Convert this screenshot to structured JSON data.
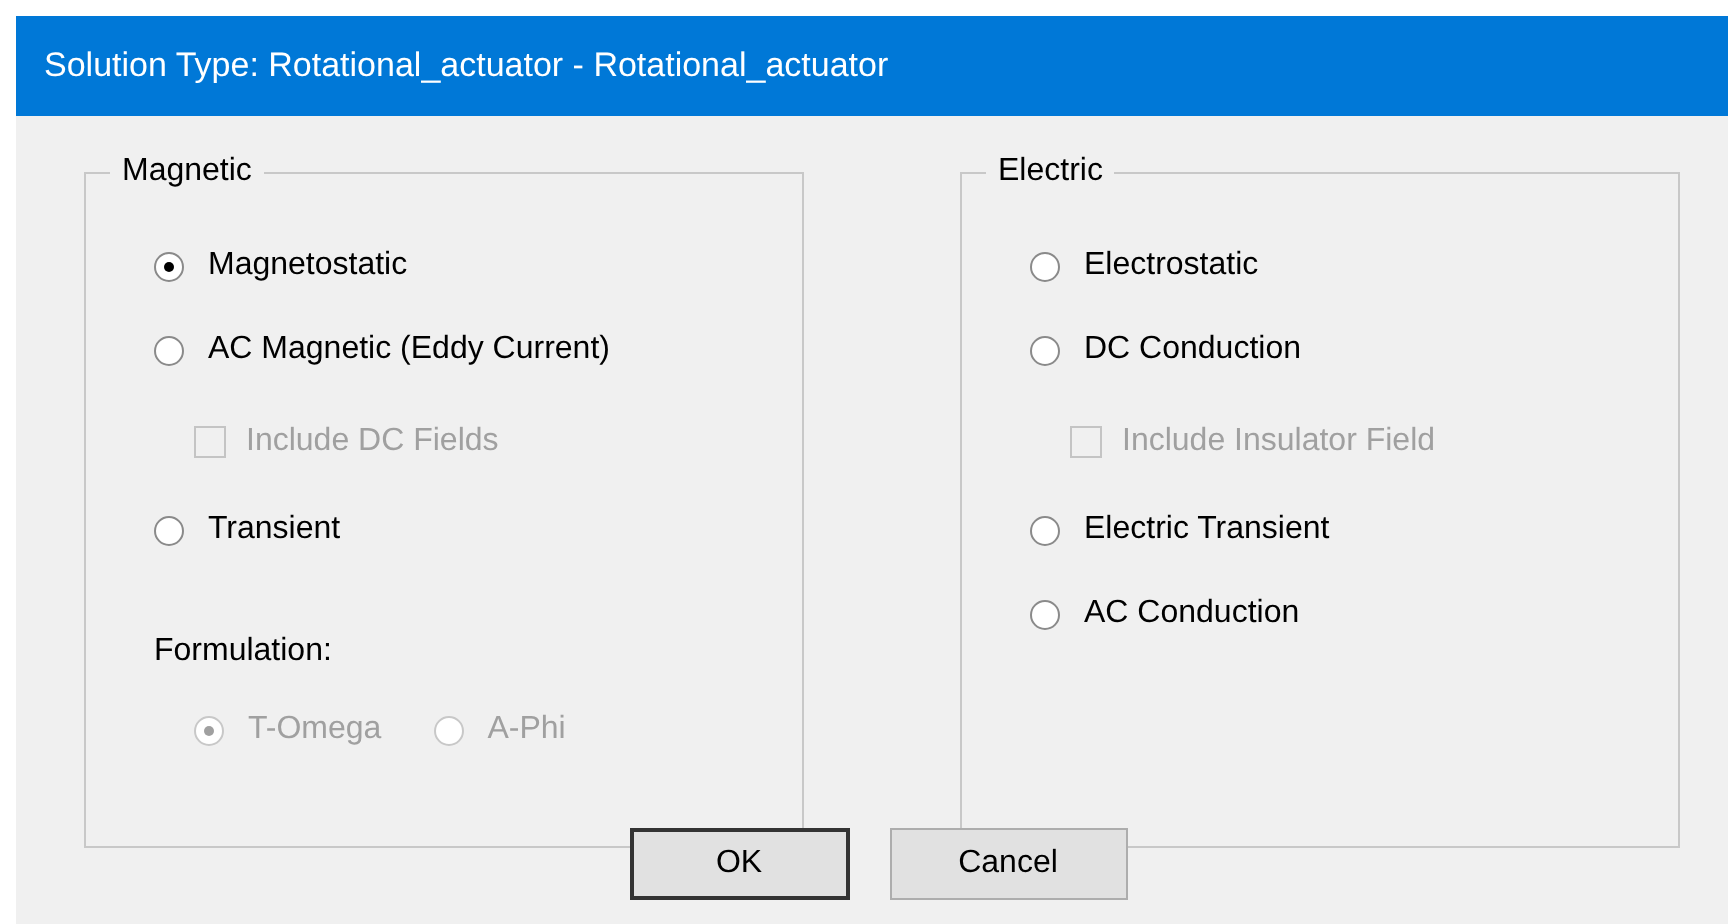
{
  "window": {
    "title": "Solution Type: Rotational_actuator - Rotational_actuator"
  },
  "groups": [
    {
      "title": "Magnetic",
      "items": [
        {
          "kind": "radio",
          "label": "Magnetostatic",
          "selected": true,
          "disabled": false
        },
        {
          "kind": "radio",
          "label": "AC Magnetic (Eddy Current)",
          "selected": false,
          "disabled": false
        },
        {
          "kind": "checkbox",
          "label": "Include DC Fields",
          "checked": false,
          "disabled": true
        },
        {
          "kind": "radio",
          "label": "Transient",
          "selected": false,
          "disabled": false
        },
        {
          "kind": "label",
          "label": "Formulation:"
        },
        {
          "kind": "radio_row",
          "options": [
            {
              "label": "T-Omega",
              "selected": true,
              "disabled": true
            },
            {
              "label": "A-Phi",
              "selected": false,
              "disabled": true
            }
          ]
        }
      ]
    },
    {
      "title": "Electric",
      "items": [
        {
          "kind": "radio",
          "label": "Electrostatic",
          "selected": false,
          "disabled": false
        },
        {
          "kind": "radio",
          "label": "DC Conduction",
          "selected": false,
          "disabled": false
        },
        {
          "kind": "checkbox",
          "label": "Include Insulator Field",
          "checked": false,
          "disabled": true
        },
        {
          "kind": "radio",
          "label": "Electric Transient",
          "selected": false,
          "disabled": false
        },
        {
          "kind": "radio",
          "label": "AC Conduction",
          "selected": false,
          "disabled": false
        }
      ]
    }
  ],
  "buttons": [
    {
      "label": "OK",
      "default": true
    },
    {
      "label": "Cancel",
      "default": false
    }
  ]
}
